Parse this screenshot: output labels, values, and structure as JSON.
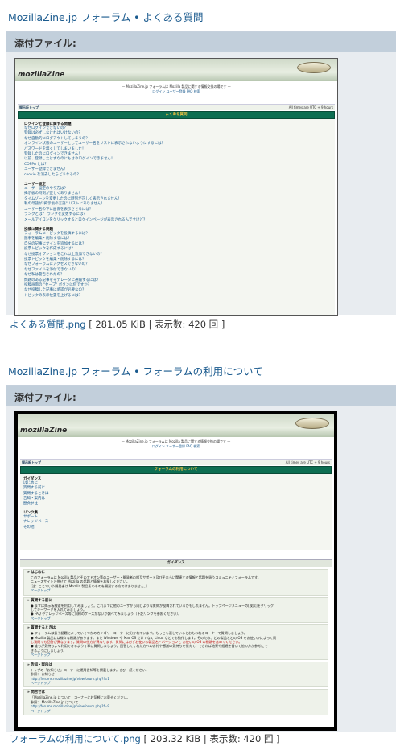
{
  "posts": [
    {
      "title": "MozillaZine.jp フォーラム • よくある質問",
      "attach_label": "添付ファイル:",
      "file_name": "よくある質問.png",
      "file_meta": "[ 281.05 KiB | 表示数: 420 回 ]",
      "shot": {
        "logo": "mozillaZine",
        "tagline": "— MozillaZine.jp フォーラムは Mozilla 製品に関する情報交換の場です —",
        "links": "ログイン  ユーザー登録  FAQ  検索",
        "board_index": "掲示板トップ",
        "timezone": "All times are UTC + 9 hours",
        "green_title": "よくある質問",
        "sections": [
          {
            "title": "ログインと登録に関する問題",
            "items": [
              "なぜログインできないの？",
              "登録は必ずしなければいけないの？",
              "なぜ自動的にログアウトしてしまうの？",
              "オンライン状態のユーザーとしてユーザー名をリストに表示されないようにするには？",
              "パスワードを無くしてしまいました！",
              "登録したのにログインできません！",
              "以前、登録したはずなのにもはやログインできません！",
              "COPPA とは？",
              "ユーザー登録できません！",
              "cookie を消去したらどうなるの？"
            ]
          },
          {
            "title": "ユーザー設定",
            "items": [
              "ユーザー設定のやり方は？",
              "掲示板の時刻が正しくありません！",
              "タイムゾーンを変更したのに時刻が正しく表示されません！",
              "私の母語が\"掲示板の言語\" リストにありません！",
              "ユーザー名の下に画像を表示させるには？",
              "ランクとは？ ランクを変更するには？",
              "メールアイコンをクリックするとログインページが表示されるんですけど？"
            ]
          },
          {
            "title": "投稿に関する問題",
            "items": [
              "フォーラムにトピックを投稿するには？",
              "記事を編集・削除するには？",
              "自分の記事にサインを追加するには？",
              "投票トピックを作成するには？",
              "なぜ投票オプションをこれ以上追加できないの？",
              "投票トピックを編集・削除するには？",
              "なぜフォーラムにアクセスできないの？",
              "なぜファイルを添付できないの？",
              "なぜ私は警告されたの？",
              "問題のある記事をモデレータに通報するには？",
              "投稿画面の \"セーブ\" ボタンは何ですか？",
              "なぜ投稿した記事に承認が必要なの？",
              "トピックの表示位置を上げるには？"
            ]
          }
        ]
      }
    },
    {
      "title": "MozillaZine.jp フォーラム • フォーラムの利用について",
      "attach_label": "添付ファイル:",
      "file_name": "フォーラムの利用について.png",
      "file_meta": "[ 203.32 KiB | 表示数: 420 回 ]",
      "shot": {
        "logo": "mozillaZine",
        "tagline": "— MozillaZine.jp フォーラムは Mozilla 製品に関する情報交換の場です —",
        "links": "ログイン  ユーザー登録  FAQ  検索",
        "board_index": "掲示板トップ",
        "timezone": "All times are UTC + 9 hours",
        "green_title": "フォーラムの利用について",
        "guide_title": "ガイダンス",
        "guide_items": [
          "はじめに",
          "質問する前に",
          "質問するときは",
          "告知・案内は",
          "問合せは"
        ],
        "links_title": "リンク集",
        "link_items": [
          "サポート",
          "ナレッジベース",
          "その他"
        ],
        "guidance_header": "ガイダンス",
        "blocks": [
          {
            "h": "» はじめに",
            "lines": [
              "このフォーラムは Mozilla 製品とそのアドオン等のユーザー・開発者の相互サポート及びそれらに関連する情報と話題を扱うコミュニティフォーラムです。",
              "ニュースサイトと併せて Mozilla の話題と情報をお探しください。",
              "[注：ここでいう開発者は Mozilla 製品そのものを開発する方ではありません。]"
            ],
            "top": "ページトップ"
          },
          {
            "h": "» 質問する前に",
            "lines": [
              "● まずは掲示板検索を利用してみましょう。これまでに他のユーザから同じような質問が投稿されているかもしれません。トップページメニューの[検索]をクリック",
              "   してキーワードを入れてみましょう。",
              "● FAQ やナレッジベース等に同様のケースがないか調べてみましょう（下記リンクを参照ください）。"
            ],
            "top": "ページトップ"
          },
          {
            "h": "» 質問するときは",
            "lines": [
              "● フォーラムは扱う話題によっていくつかのカテゴリーコーナーに分かれています。もっとも適しているとおもわれるコーナーで質問しましょう。",
              "● Mozilla 製品には様々な種類があります。また Windows や Mac OS だけでなく Linux などでも動作します。そのため、どの製品とどの OS をお使いかによって同",
              "   じ質問でも回答が異なります。質問の仕方が異なります。質問には必ずお使いの製品名・バージョンと お使いの OS の種類を含めてください。",
              "● 誰もが気持ちよく利用できるよう丁寧に質問しましょう。回答してくれた方へのお礼や感謝の気持ちを伝えて、できれば結果や経過を書いて他の方が参考にで",
              "   きるようにしましょう。"
            ],
            "top": "ページトップ"
          },
          {
            "h": "» 告知・案内は",
            "lines": [
              "トップの「お知らせ」コーナーに運用告知等を掲載します。ぜひ一読ください。",
              "参照： お知らせ",
              "http://forums.mozillazine.jp/viewforum.php?f=1"
            ],
            "top": "ページトップ"
          },
          {
            "h": "» 問合せは",
            "lines": [
              "「MozillaZine.jp について」コーナーにお気軽にお寄せください。",
              "参照： MozillaZine.jp について",
              "http://forums.mozillazine.jp/viewforum.php?f=9"
            ],
            "top": "ページトップ"
          }
        ]
      }
    }
  ],
  "colors": {
    "title_link": "#1a5a8e",
    "attach_header": "#c2cfdb",
    "attach_body": "#e8ecf0",
    "green_bar": "#0d6e52"
  }
}
